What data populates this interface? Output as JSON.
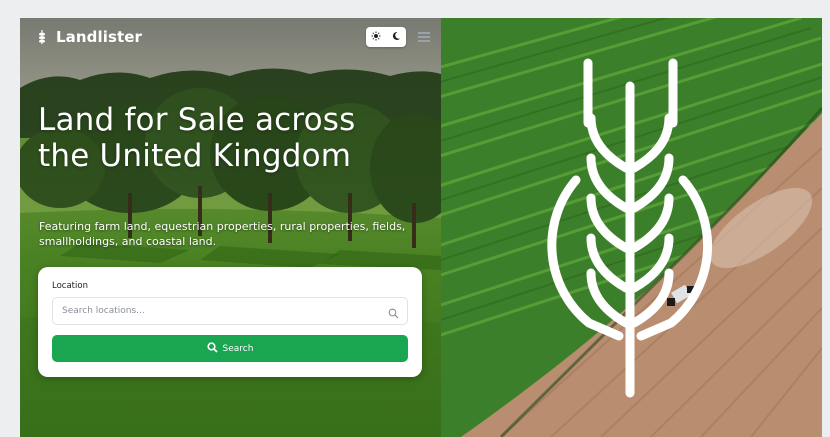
{
  "header": {
    "brand_name": "Landlister",
    "logo_icon": "wheat-icon",
    "theme_light_icon": "sun-icon",
    "theme_dark_icon": "moon-icon",
    "menu_icon": "hamburger-menu-icon"
  },
  "hero": {
    "title": "Land for Sale across the United Kingdom",
    "subtitle": "Featuring farm land, equestrian properties, rural properties, fields, smallholdings, and coastal land."
  },
  "search": {
    "location_label": "Location",
    "location_placeholder": "Search locations...",
    "location_value": "",
    "button_label": "Search"
  },
  "feature_image": {
    "emblem_icon": "wheat-emblem-icon"
  },
  "colors": {
    "accent": "#1aa551",
    "text_on_image": "#ffffff",
    "card_bg": "#ffffff"
  }
}
